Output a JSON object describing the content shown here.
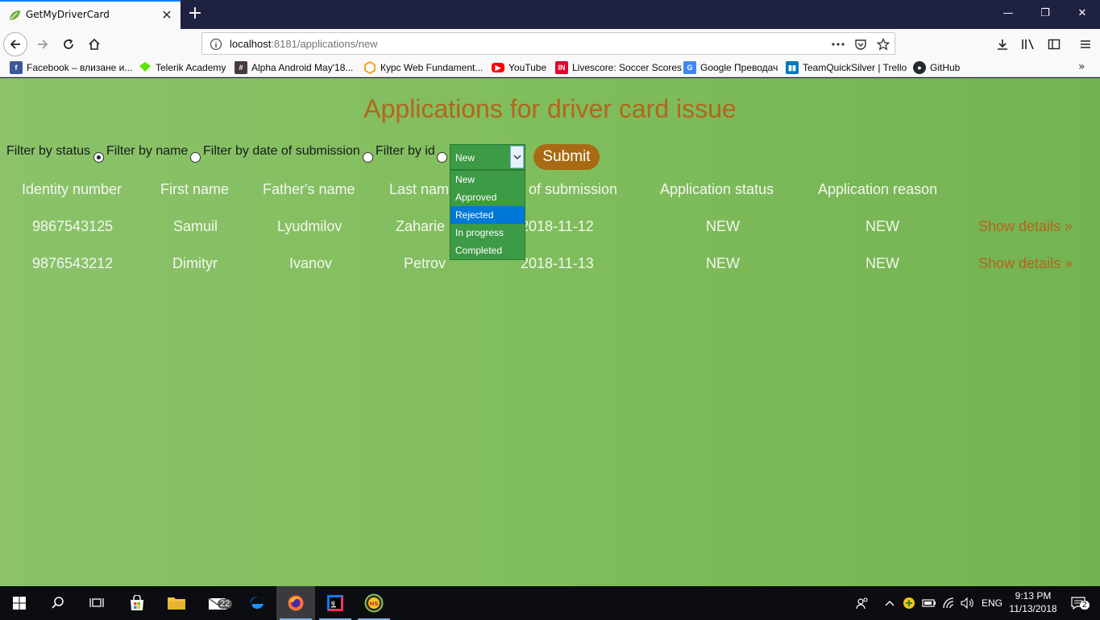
{
  "browser": {
    "tab_title": "GetMyDriverCard",
    "url_host": "localhost",
    "url_rest": ":8181/applications/new",
    "bookmarks": [
      {
        "label": "Facebook – влизане и...",
        "icon": "facebook-icon",
        "color": "#3b5998"
      },
      {
        "label": "Telerik Academy",
        "icon": "telerik-icon",
        "color": "#5ce500"
      },
      {
        "label": "Alpha Android May'18...",
        "icon": "hash-icon",
        "color": "#4a3b3b"
      },
      {
        "label": "Курс Web Fundament...",
        "icon": "softuni-icon",
        "color": "#f6a623"
      },
      {
        "label": "YouTube",
        "icon": "youtube-icon",
        "color": "#ff0000"
      },
      {
        "label": "Livescore: Soccer Scores",
        "icon": "livescore-icon",
        "color": "#e4002b"
      },
      {
        "label": "Google Преводач",
        "icon": "google-translate-icon",
        "color": "#4285f4"
      },
      {
        "label": "TeamQuickSilver | Trello",
        "icon": "trello-icon",
        "color": "#0079bf"
      },
      {
        "label": "GitHub",
        "icon": "github-icon",
        "color": "#24292e"
      }
    ]
  },
  "page": {
    "title": "Applications for driver card issue",
    "filters": {
      "by_status": "Filter by status",
      "by_name": "Filter by name",
      "by_date": "Filter by date of submission",
      "by_id": "Filter by id"
    },
    "status_select": {
      "value": "New",
      "options": [
        "New",
        "Approved",
        "Rejected",
        "In progress",
        "Completed"
      ],
      "highlighted": "Rejected"
    },
    "submit_label": "Submit",
    "table": {
      "headers": [
        "Identity number",
        "First name",
        "Father's name",
        "Last nam",
        "of submission",
        "Application status",
        "Application reason"
      ],
      "rows": [
        {
          "id": "9867543125",
          "first": "Samuil",
          "father": "Lyudmilov",
          "last": "Zaharie",
          "date": "2018-11-12",
          "status": "NEW",
          "reason": "NEW",
          "link": "Show details »"
        },
        {
          "id": "9876543212",
          "first": "Dimityr",
          "father": "Ivanov",
          "last": "Petrov",
          "date": "2018-11-13",
          "status": "NEW",
          "reason": "NEW",
          "link": "Show details »"
        }
      ]
    }
  },
  "taskbar": {
    "mail_badge": "22",
    "language": "ENG",
    "time": "9:13 PM",
    "date": "11/13/2018",
    "notification_count": "2"
  },
  "colors": {
    "title": "#b5651d",
    "page_bg": "#80bd5c",
    "select_bg": "#3d9a45",
    "submit_bg": "#a86a12",
    "highlight": "#0078d7"
  }
}
